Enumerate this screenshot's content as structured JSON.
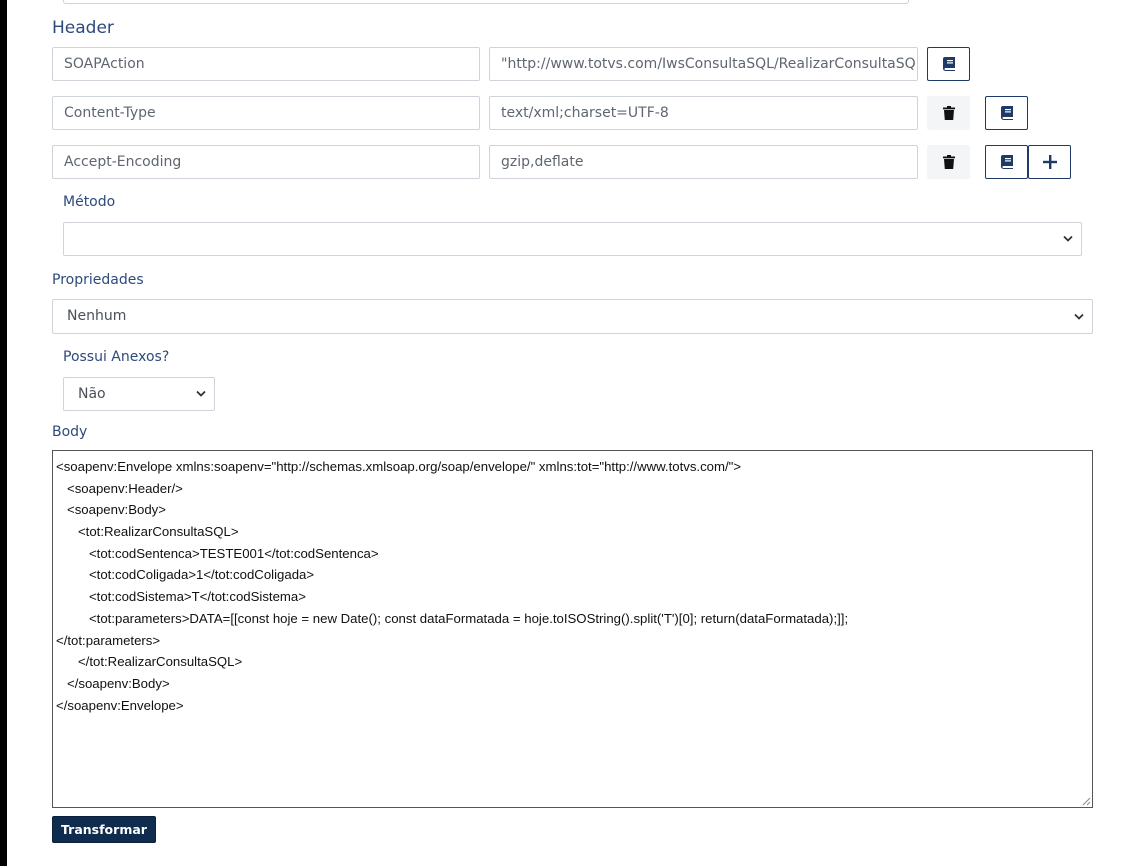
{
  "header": {
    "title": "Header"
  },
  "headers": [
    {
      "key": "SOAPAction",
      "value": "\"http://www.totvs.com/IwsConsultaSQL/RealizarConsultaSQL\""
    },
    {
      "key": "Content-Type",
      "value": "text/xml;charset=UTF-8"
    },
    {
      "key": "Accept-Encoding",
      "value": "gzip,deflate"
    }
  ],
  "icons": {
    "book": "book-icon",
    "trash": "trash-icon",
    "plus": "plus-icon",
    "chevron": "chevron-down-icon"
  },
  "metodo": {
    "label": "Método",
    "value": ""
  },
  "propriedades": {
    "label": "Propriedades",
    "value": "Nenhum"
  },
  "anexos": {
    "label": "Possui Anexos?",
    "value": "Não"
  },
  "body": {
    "label": "Body",
    "lines": [
      "<soapenv:Envelope xmlns:soapenv=\"http://schemas.xmlsoap.org/soap/envelope/\" xmlns:tot=\"http://www.totvs.com/\">",
      "   <soapenv:Header/>",
      "   <soapenv:Body>",
      "      <tot:RealizarConsultaSQL>",
      "         <tot:codSentenca>TESTE001</tot:codSentenca>",
      "         <tot:codColigada>1</tot:codColigada>",
      "         <tot:codSistema>T</tot:codSistema>",
      "         <tot:parameters>DATA=[[const hoje = new Date(); const dataFormatada = hoje.toISOString().split('T')[0]; return(dataFormatada);]];",
      "</tot:parameters>",
      "      </tot:RealizarConsultaSQL>",
      "   </soapenv:Body>",
      "</soapenv:Envelope>"
    ]
  },
  "actions": {
    "transform_label": "Transformar"
  }
}
